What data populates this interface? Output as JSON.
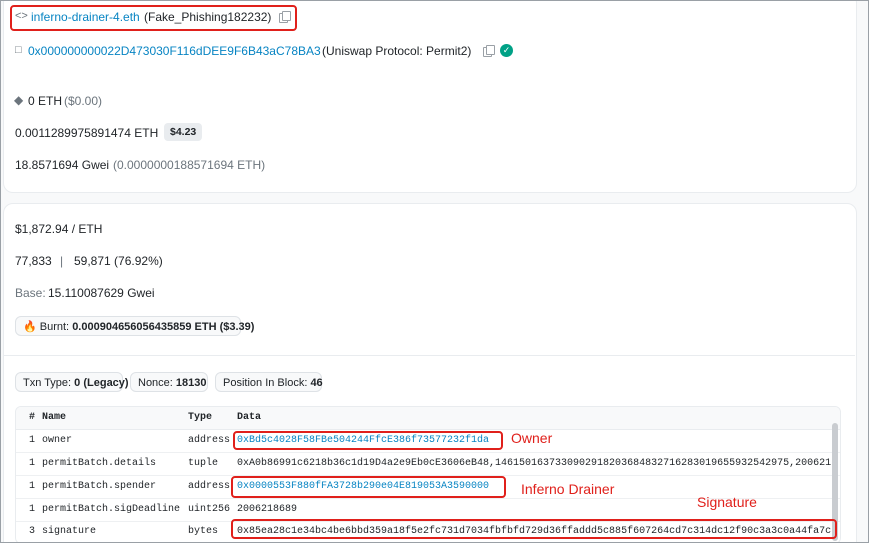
{
  "top": {
    "to_name": "inferno-drainer-4.eth",
    "to_tag": "(Fake_Phishing182232)",
    "contract_address": "0x000000000022D473030F116dDEE9F6B43aC78BA3",
    "contract_name": "(Uniswap Protocol: Permit2)",
    "value_eth": "0 ETH",
    "value_usd": "($0.00)",
    "fee_eth": "0.0011289975891474 ETH",
    "fee_usd": "$4.23",
    "gas_price": "18.8571694 Gwei",
    "gas_price_eth": "(0.0000000188571694 ETH)"
  },
  "details": {
    "eth_price": "$1,872.94 / ETH",
    "gas_limit": "77,833",
    "gas_sep": "|",
    "gas_used": "59,871 (76.92%)",
    "base_label": "Base:",
    "base_value": "15.110087629 Gwei",
    "burnt_label": "Burnt:",
    "burnt_value": "0.000904656056435859 ETH ($3.39)",
    "txn_type_label": "Txn Type:",
    "txn_type_value": "0 (Legacy)",
    "nonce_label": "Nonce:",
    "nonce_value": "18130",
    "position_label": "Position In Block:",
    "position_value": "46"
  },
  "table": {
    "headers": {
      "num": "#",
      "name": "Name",
      "type": "Type",
      "data": "Data"
    },
    "rows": [
      {
        "num": "1",
        "name": "owner",
        "type": "address",
        "data": "0xBd5c4028F58FBe504244FfcE386f73577232f1da"
      },
      {
        "num": "1",
        "name": "permitBatch.details",
        "type": "tuple",
        "data": "0xA0b86991c6218b36c1d19D4a2e9Eb0cE3606eB48,1461501637330902918203684832716283019655932542975,200621"
      },
      {
        "num": "1",
        "name": "permitBatch.spender",
        "type": "address",
        "data": "0x0000553F880fFA3728b290e04E819053A3590000"
      },
      {
        "num": "1",
        "name": "permitBatch.sigDeadline",
        "type": "uint256",
        "data": "2006218689"
      },
      {
        "num": "3",
        "name": "signature",
        "type": "bytes",
        "data": "0x85ea28c1e34bc4be6bbd359a18f5e2fc731d7034fbfbfd729d36ffaddd5c885f607264cd7c314dc12f90c3a3c0a44fa7c"
      }
    ]
  },
  "annotations": {
    "owner": "Owner",
    "drainer": "Inferno Drainer",
    "signature": "Signature"
  },
  "colors": {
    "accent": "#0784c3",
    "highlight": "#e0201b",
    "verified": "#00a186"
  }
}
